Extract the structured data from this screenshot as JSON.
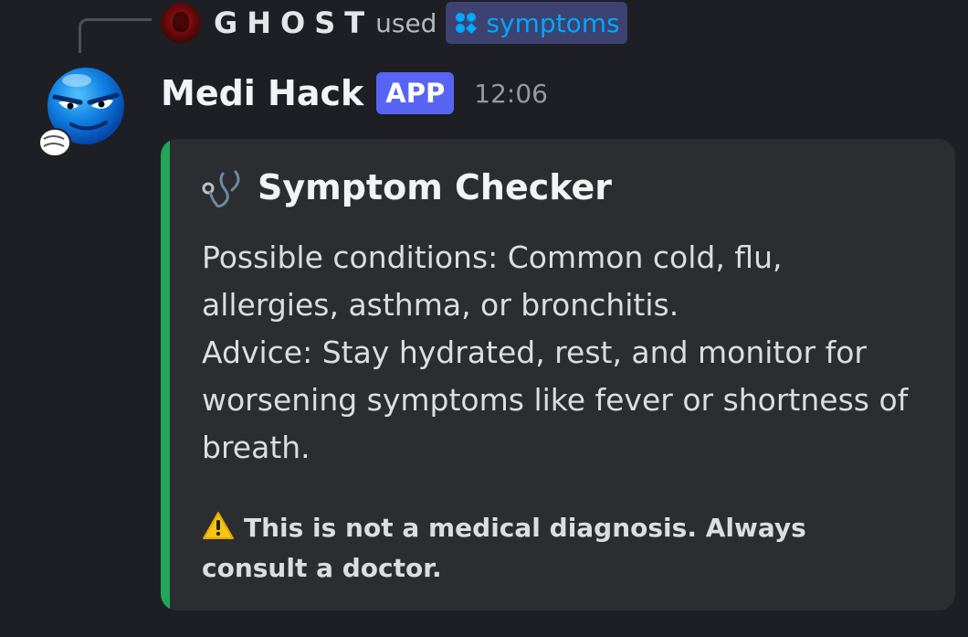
{
  "reply": {
    "username": "GHOST",
    "used_text": "used",
    "command": "symptoms"
  },
  "message": {
    "author": "Medi Hack",
    "badge": "APP",
    "time": "12:06"
  },
  "embed": {
    "accent_color": "#23a55a",
    "title": "Symptom Checker",
    "title_icon": "stethoscope-icon",
    "lines": [
      "Possible conditions: Common cold, flu, allergies, asthma, or bronchitis.",
      "Advice: Stay hydrated, rest, and monitor for worsening symptoms like fever or shortness of breath."
    ],
    "footer_icon": "warning-icon",
    "footer": "This is not a medical diagnosis. Always consult a doctor."
  },
  "colors": {
    "background": "#1e1f24",
    "embed_background": "#2b2d31",
    "badge": "#5865f2",
    "command_chip": "#3d4270"
  }
}
